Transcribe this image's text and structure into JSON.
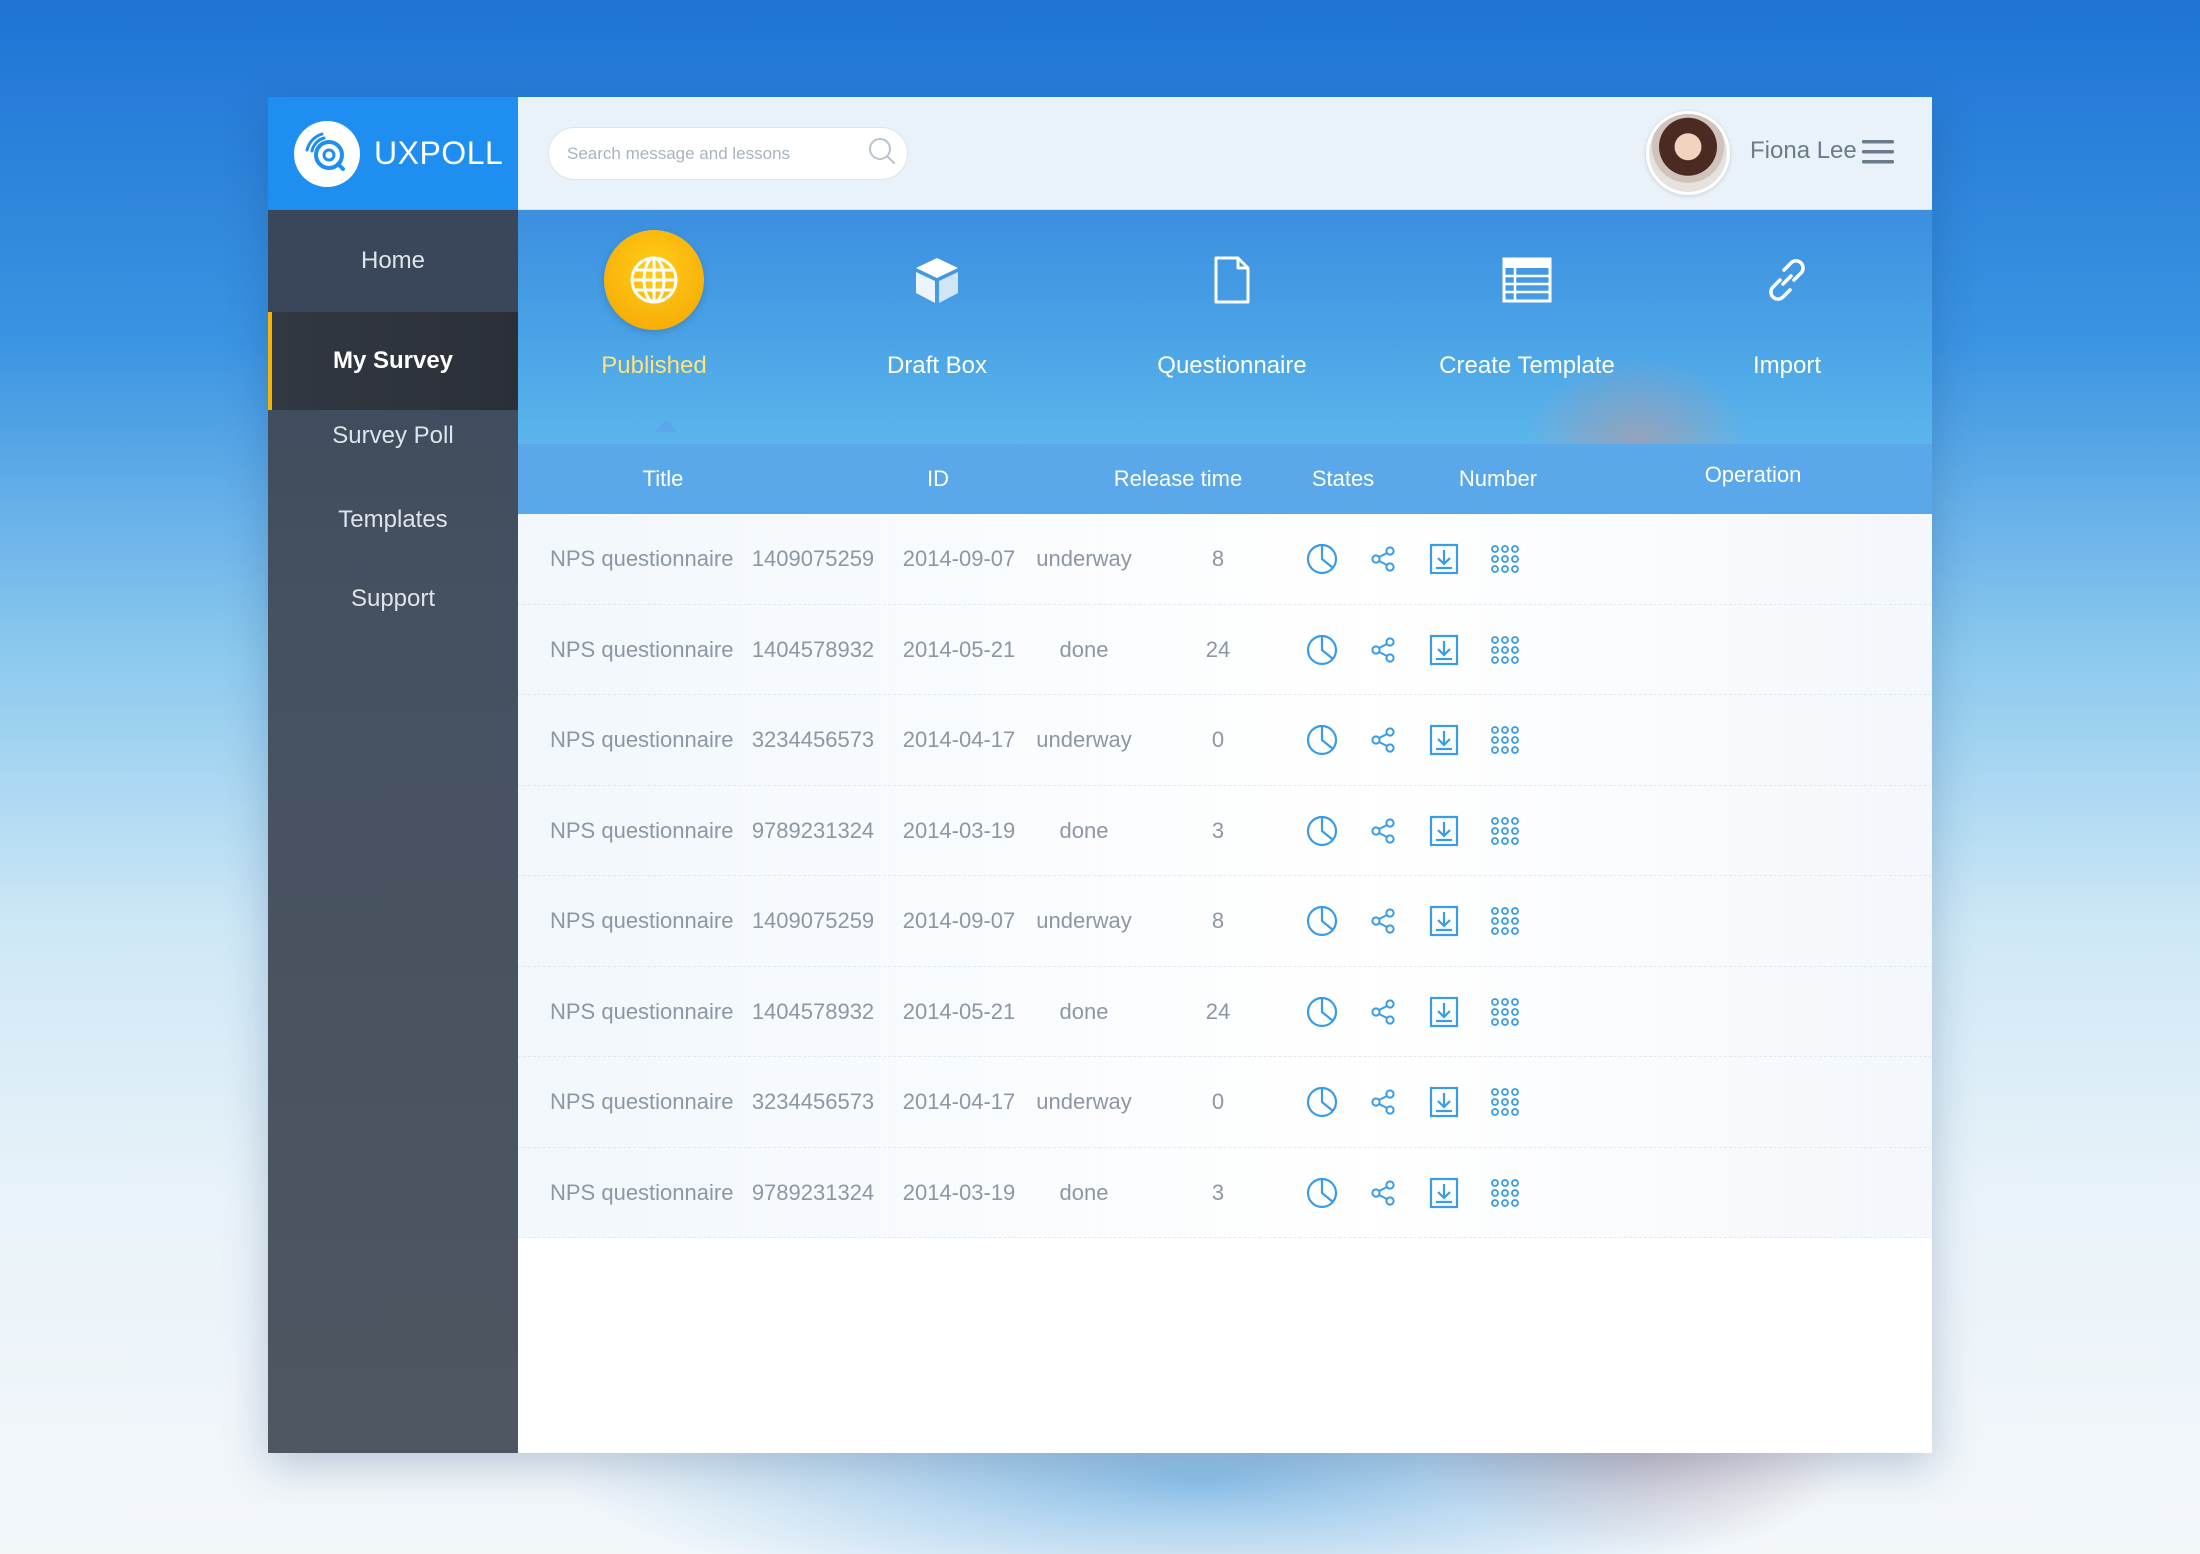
{
  "brand": {
    "name": "UXPOLL",
    "logo_icon": "poll-logo-icon"
  },
  "sidebar": {
    "items": [
      {
        "label": "Home"
      },
      {
        "label": "My Survey",
        "active": true
      },
      {
        "label": "Survey Poll"
      },
      {
        "label": "Templates"
      },
      {
        "label": "Support"
      }
    ]
  },
  "header": {
    "search_placeholder": "Search message and lessons",
    "user_name": "Fiona Lee"
  },
  "tabs": [
    {
      "label": "Published",
      "icon": "globe-icon",
      "active": true
    },
    {
      "label": "Draft Box",
      "icon": "box-icon"
    },
    {
      "label": "Questionnaire",
      "icon": "document-icon"
    },
    {
      "label": "Create Template",
      "icon": "table-icon"
    },
    {
      "label": "Import",
      "icon": "link-icon"
    }
  ],
  "table": {
    "headers": [
      "Title",
      "ID",
      "Release time",
      "States",
      "Number",
      "Operation"
    ],
    "rows": [
      [
        "NPS questionnaire",
        "1409075259",
        "2014-09-07",
        "underway",
        "8"
      ],
      [
        "NPS questionnaire",
        "1404578932",
        "2014-05-21",
        "done",
        "24"
      ],
      [
        "NPS questionnaire",
        "3234456573",
        "2014-04-17",
        "underway",
        "0"
      ],
      [
        "NPS questionnaire",
        "9789231324",
        "2014-03-19",
        "done",
        "3"
      ],
      [
        "NPS questionnaire",
        "1409075259",
        "2014-09-07",
        "underway",
        "8"
      ],
      [
        "NPS questionnaire",
        "1404578932",
        "2014-05-21",
        "done",
        "24"
      ],
      [
        "NPS questionnaire",
        "3234456573",
        "2014-04-17",
        "underway",
        "0"
      ],
      [
        "NPS questionnaire",
        "9789231324",
        "2014-03-19",
        "done",
        "3"
      ]
    ],
    "operation_icons": [
      "pie-chart-icon",
      "share-icon",
      "download-icon",
      "grid-menu-icon"
    ]
  },
  "colors": {
    "brand_blue": "#1e8ff0",
    "active_tab": "#f5a400",
    "accent_yellow": "#f5b400",
    "icon_blue": "#3a9be8"
  }
}
